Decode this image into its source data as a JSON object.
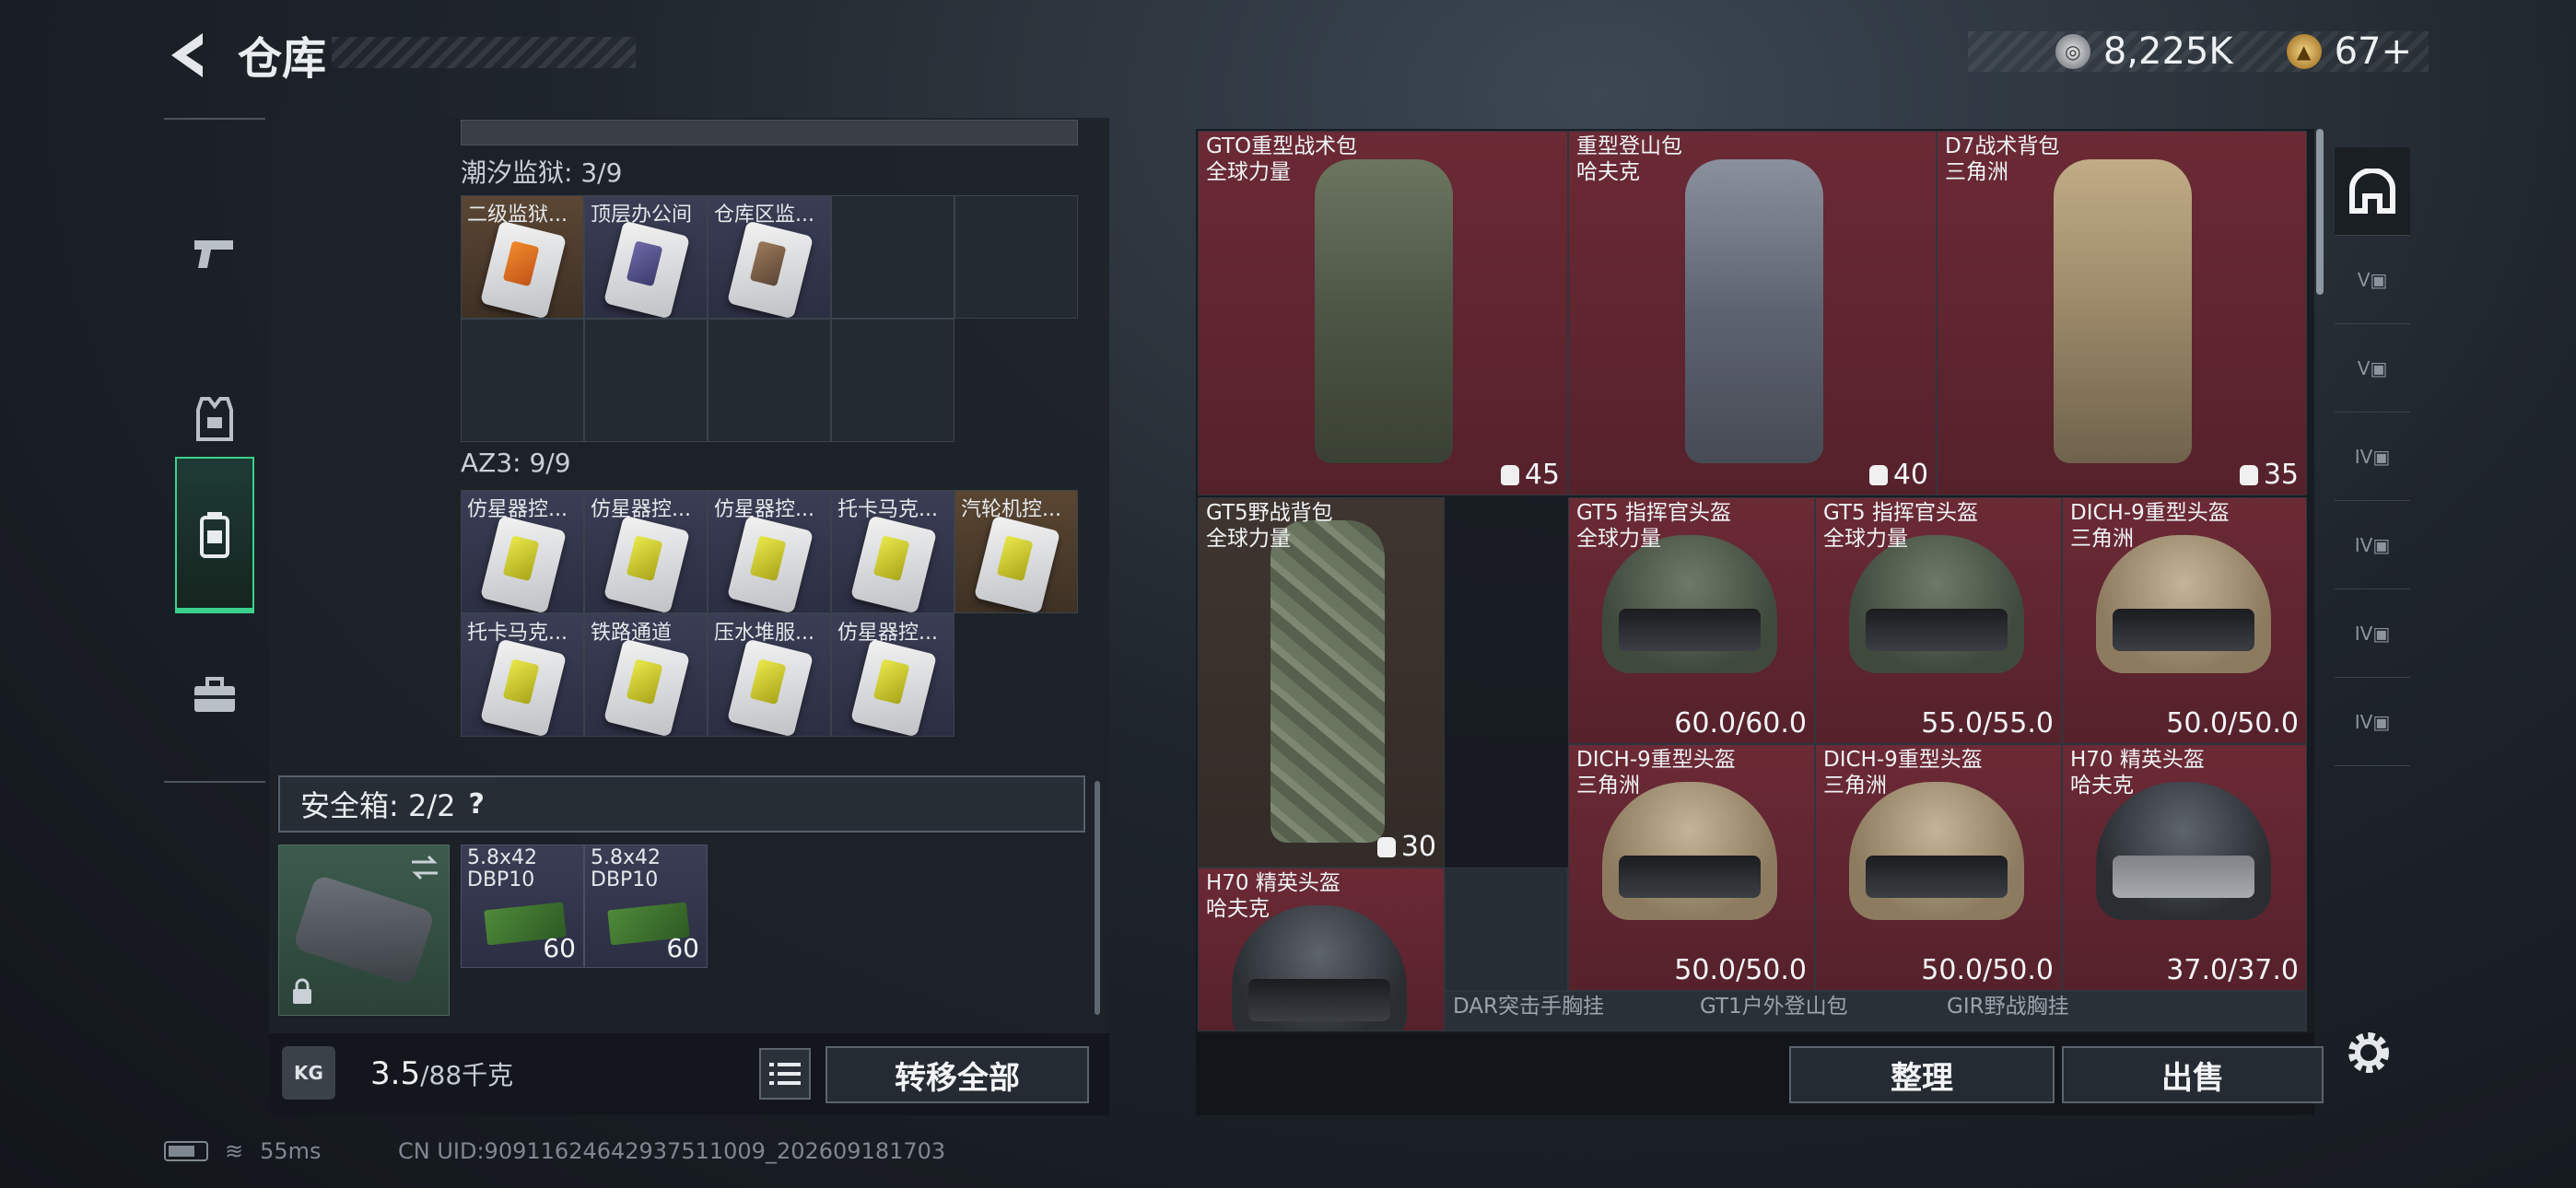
{
  "header": {
    "title": "仓库"
  },
  "currency": [
    {
      "icon": "silver-coin-icon",
      "value": "8,225K"
    },
    {
      "icon": "gold-coin-icon",
      "value": "67+"
    }
  ],
  "left_sidebar": [
    {
      "icon": "pistol-icon",
      "active": false
    },
    {
      "icon": "armor-vest-icon",
      "active": false
    },
    {
      "icon": "backpack-icon",
      "active": true
    },
    {
      "icon": "toolbox-icon",
      "active": false
    }
  ],
  "sections": [
    {
      "title": "潮汐监狱: 3/9",
      "items": [
        {
          "label": "二级监狱...",
          "color": "orange"
        },
        {
          "label": "顶层办公间",
          "color": "purple"
        },
        {
          "label": "仓库区监...",
          "color": "brown"
        }
      ]
    },
    {
      "title": "AZ3: 9/9",
      "items": [
        {
          "label": "仿星器控..."
        },
        {
          "label": "仿星器控..."
        },
        {
          "label": "仿星器控..."
        },
        {
          "label": "托卡马克..."
        },
        {
          "label": "汽轮机控..."
        },
        {
          "label": "托卡马克..."
        },
        {
          "label": "铁路通道"
        },
        {
          "label": "压水堆服..."
        },
        {
          "label": "仿星器控..."
        }
      ]
    }
  ],
  "safebox": {
    "title": "安全箱: 2/2",
    "help": "?",
    "items": [
      {
        "label_line1": "5.8x42",
        "label_line2": "DBP10",
        "qty": "60"
      },
      {
        "label_line1": "5.8x42",
        "label_line2": "DBP10",
        "qty": "60"
      }
    ]
  },
  "weight": {
    "current": "3.5",
    "max": "/88千克",
    "icon_label": "KG"
  },
  "buttons": {
    "transfer_all": "转移全部",
    "sort": "整理",
    "sell": "出售"
  },
  "right_grid": [
    {
      "name": "GTO重型战术包",
      "brand": "全球力量",
      "value": "45",
      "kind": "backpack"
    },
    {
      "name": "重型登山包",
      "brand": "哈夫克",
      "value": "40",
      "kind": "backpack"
    },
    {
      "name": "D7战术背包",
      "brand": "三角洲",
      "value": "35",
      "kind": "backpack"
    },
    {
      "name": "GT5野战背包",
      "brand": "全球力量",
      "value": "30",
      "kind": "backpack"
    },
    {
      "name": "GT5 指挥官头盔",
      "brand": "全球力量",
      "value": "60.0/60.0",
      "kind": "helmet"
    },
    {
      "name": "GT5 指挥官头盔",
      "brand": "全球力量",
      "value": "55.0/55.0",
      "kind": "helmet"
    },
    {
      "name": "DICH-9重型头盔",
      "brand": "三角洲",
      "value": "50.0/50.0",
      "kind": "helmet"
    },
    {
      "name": "DICH-9重型头盔",
      "brand": "三角洲",
      "value": "50.0/50.0",
      "kind": "helmet"
    },
    {
      "name": "DICH-9重型头盔",
      "brand": "三角洲",
      "value": "50.0/50.0",
      "kind": "helmet"
    },
    {
      "name": "H70 精英头盔",
      "brand": "哈夫克",
      "value": "37.0/37.0",
      "kind": "helmet"
    },
    {
      "name": "H70 精英头盔",
      "brand": "哈夫克",
      "value": "",
      "kind": "helmet"
    },
    {
      "name": "DAR突击手胸挂",
      "brand": "",
      "value": "",
      "kind": "vest"
    },
    {
      "name": "GT1户外登山包",
      "brand": "",
      "value": "",
      "kind": "backpack"
    },
    {
      "name": "GIR野战胸挂",
      "brand": "",
      "value": "",
      "kind": "vest"
    }
  ],
  "right_sidebar": [
    {
      "icon": "helmet-filter-icon",
      "label": ""
    },
    {
      "icon": "case-v-icon",
      "label": "V"
    },
    {
      "icon": "case-v-icon",
      "label": "V"
    },
    {
      "icon": "case-iv-icon",
      "label": "IV"
    },
    {
      "icon": "case-iv-icon",
      "label": "IV"
    },
    {
      "icon": "case-iv-icon",
      "label": "IV"
    },
    {
      "icon": "case-iv-icon",
      "label": "IV"
    }
  ],
  "status": {
    "ping": "55ms",
    "uid": "CN UID:9091162464293751100​9_202609181703"
  },
  "colors": {
    "accent_green": "#3bd18c",
    "rare_red": "#6b2a35",
    "item_purple": "#3a3d54"
  }
}
